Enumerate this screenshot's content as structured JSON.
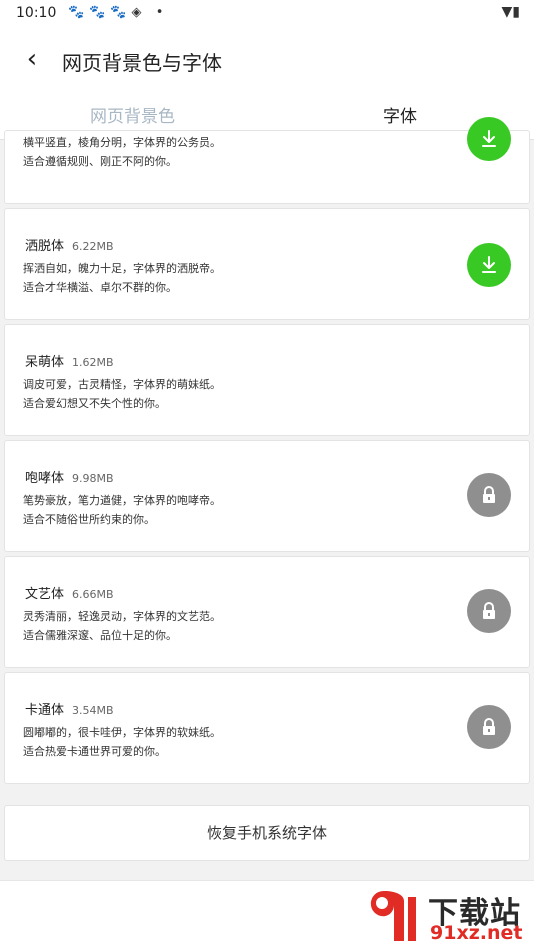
{
  "status_bar": {
    "time": "10:10",
    "left_icons": "🐾🐾🐾◈ •",
    "right_icons": "▼▮"
  },
  "header": {
    "back_icon": "‹",
    "title": "网页背景色与字体"
  },
  "tabs": [
    {
      "label": "网页背景色",
      "active": false
    },
    {
      "label": "字体",
      "active": true
    }
  ],
  "fonts": [
    {
      "name": "",
      "size": "",
      "desc_line1": "横平竖直，棱角分明，字体界的公务员。",
      "desc_line2": "适合遵循规则、刚正不阿的你。",
      "action": "download"
    },
    {
      "name": "洒脱体",
      "size": "6.22MB",
      "desc_line1": "挥洒自如，魄力十足，字体界的洒脱帝。",
      "desc_line2": "适合才华横溢、卓尔不群的你。",
      "action": "download"
    },
    {
      "name": "呆萌体",
      "size": "1.62MB",
      "desc_line1": "调皮可爱，古灵精怪，字体界的萌妹纸。",
      "desc_line2": "适合爱幻想又不失个性的你。",
      "action": "none"
    },
    {
      "name": "咆哮体",
      "size": "9.98MB",
      "desc_line1": "笔势豪放，笔力遒健，字体界的咆哮帝。",
      "desc_line2": "适合不随俗世所约束的你。",
      "action": "lock"
    },
    {
      "name": "文艺体",
      "size": "6.66MB",
      "desc_line1": "灵秀清丽，轻逸灵动，字体界的文艺范。",
      "desc_line2": "适合儒雅深邃、品位十足的你。",
      "action": "lock"
    },
    {
      "name": "卡通体",
      "size": "3.54MB",
      "desc_line1": "圆嘟嘟的，很卡哇伊，字体界的软妹纸。",
      "desc_line2": "适合热爱卡通世界可爱的你。",
      "action": "lock"
    }
  ],
  "restore_label": "恢复手机系统字体",
  "watermark": {
    "top": "下载站",
    "bottom": "91xz.net"
  },
  "colors": {
    "download": "#39c924",
    "lock": "#8f8f8f",
    "tab_underline": "#4a9fd8",
    "tab_inactive": "#a8b7c4"
  }
}
